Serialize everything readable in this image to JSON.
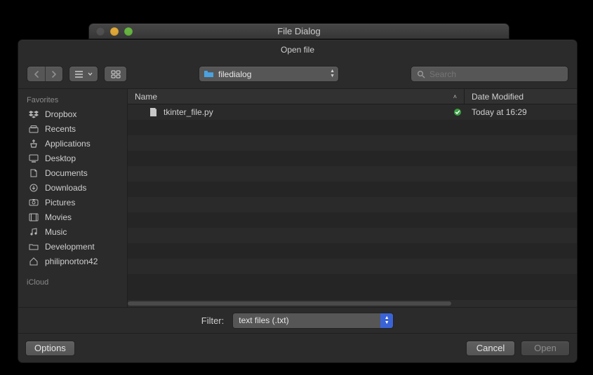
{
  "window": {
    "title": "File Dialog"
  },
  "sheet": {
    "subtitle": "Open file"
  },
  "toolbar": {
    "location_label": "filedialog",
    "search_placeholder": "Search"
  },
  "sidebar": {
    "sections": [
      {
        "label": "Favorites"
      },
      {
        "label": "iCloud"
      }
    ],
    "items": [
      {
        "icon": "dropbox-icon",
        "label": "Dropbox"
      },
      {
        "icon": "recents-icon",
        "label": "Recents"
      },
      {
        "icon": "applications-icon",
        "label": "Applications"
      },
      {
        "icon": "desktop-icon",
        "label": "Desktop"
      },
      {
        "icon": "documents-icon",
        "label": "Documents"
      },
      {
        "icon": "downloads-icon",
        "label": "Downloads"
      },
      {
        "icon": "pictures-icon",
        "label": "Pictures"
      },
      {
        "icon": "movies-icon",
        "label": "Movies"
      },
      {
        "icon": "music-icon",
        "label": "Music"
      },
      {
        "icon": "folder-icon",
        "label": "Development"
      },
      {
        "icon": "home-icon",
        "label": "philipnorton42"
      }
    ]
  },
  "filelist": {
    "columns": {
      "name": "Name",
      "modified": "Date Modified"
    },
    "rows": [
      {
        "icon": "python-file-icon",
        "name": "tkinter_file.py",
        "cloud_status": "synced",
        "modified": "Today at 16:29"
      }
    ]
  },
  "filter": {
    "label": "Filter:",
    "selected": "text files (.txt)"
  },
  "buttons": {
    "options": "Options",
    "cancel": "Cancel",
    "open": "Open"
  }
}
